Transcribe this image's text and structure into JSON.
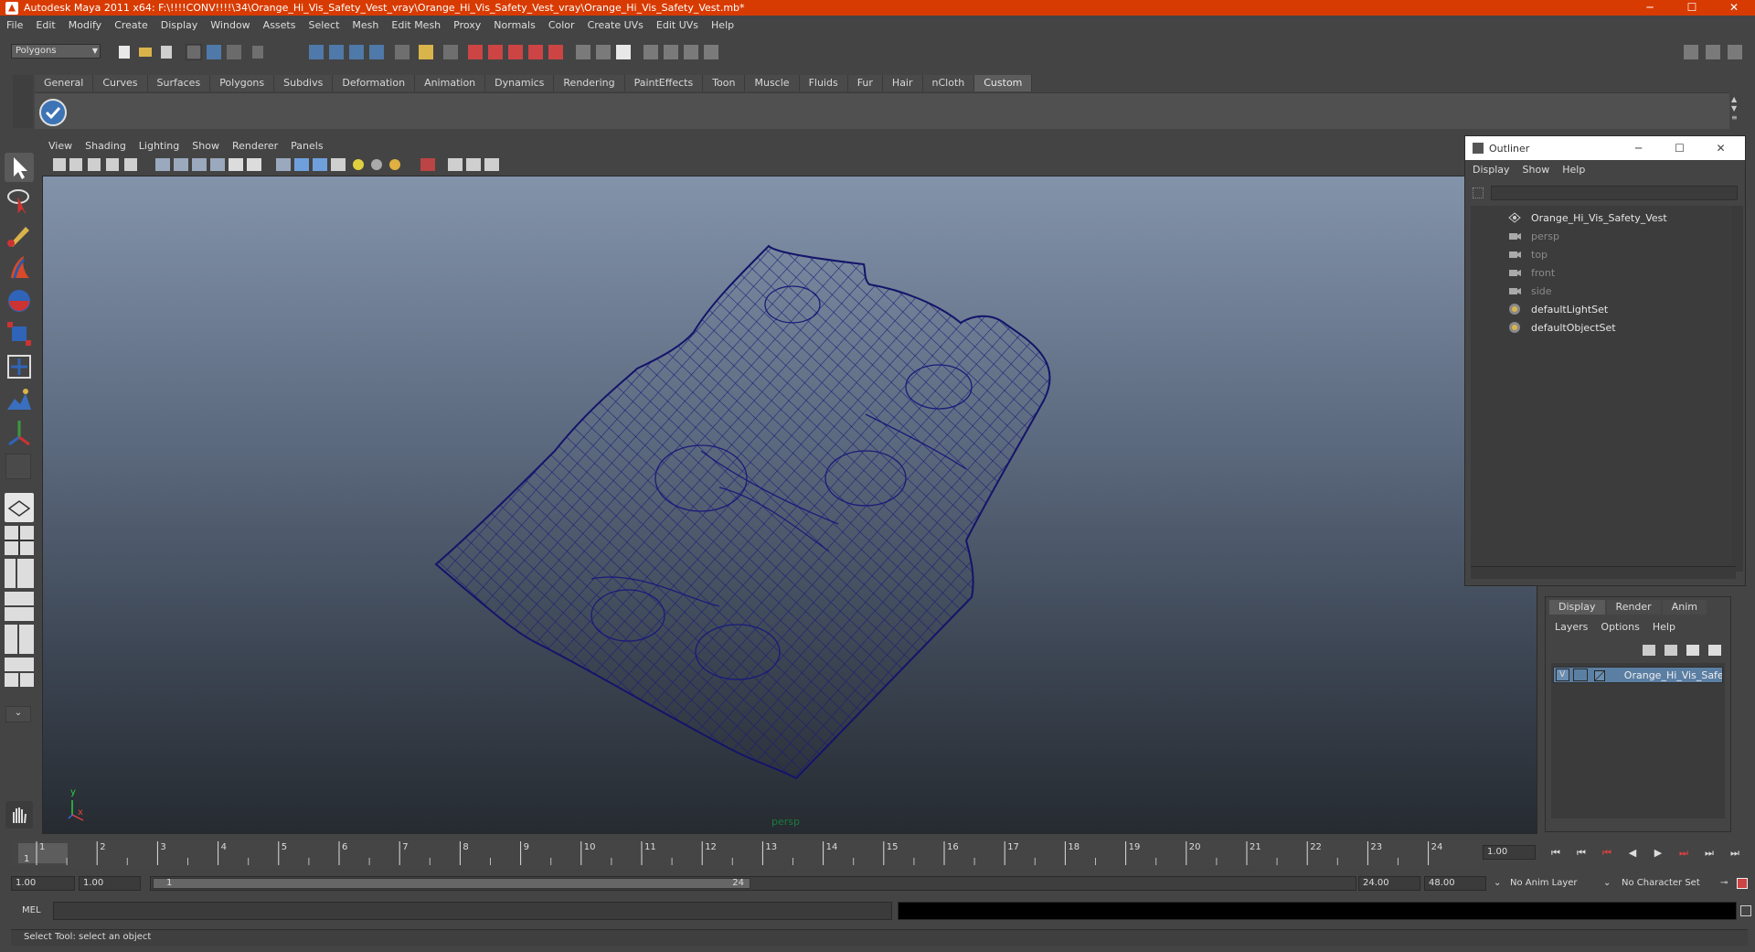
{
  "window": {
    "title": "Autodesk Maya 2011 x64: F:\\!!!!CONV!!!!\\34\\Orange_Hi_Vis_Safety_Vest_vray\\Orange_Hi_Vis_Safety_Vest_vray\\Orange_Hi_Vis_Safety_Vest.mb*",
    "minimize": "─",
    "maximize": "☐",
    "close": "✕"
  },
  "menubar": [
    "File",
    "Edit",
    "Modify",
    "Create",
    "Display",
    "Window",
    "Assets",
    "Select",
    "Mesh",
    "Edit Mesh",
    "Proxy",
    "Normals",
    "Color",
    "Create UVs",
    "Edit UVs",
    "Help"
  ],
  "statusline": {
    "mode": "Polygons"
  },
  "shelf": {
    "tabs": [
      "General",
      "Curves",
      "Surfaces",
      "Polygons",
      "Subdivs",
      "Deformation",
      "Animation",
      "Dynamics",
      "Rendering",
      "PaintEffects",
      "Toon",
      "Muscle",
      "Fluids",
      "Fur",
      "Hair",
      "nCloth",
      "Custom"
    ],
    "active_tab": "Custom"
  },
  "viewport": {
    "menu": [
      "View",
      "Shading",
      "Lighting",
      "Show",
      "Renderer",
      "Panels"
    ],
    "camera_label": "persp",
    "axis_y": "y",
    "axis_x": "x",
    "wire_color": "#1a1a7a"
  },
  "outliner": {
    "title": "Outliner",
    "menu": [
      "Display",
      "Show",
      "Help"
    ],
    "items": [
      {
        "label": "Orange_Hi_Vis_Safety_Vest",
        "icon": "mesh-transform-icon",
        "dim": false
      },
      {
        "label": "persp",
        "icon": "camera-icon",
        "dim": true
      },
      {
        "label": "top",
        "icon": "camera-icon",
        "dim": true
      },
      {
        "label": "front",
        "icon": "camera-icon",
        "dim": true
      },
      {
        "label": "side",
        "icon": "camera-icon",
        "dim": true
      },
      {
        "label": "defaultLightSet",
        "icon": "set-icon",
        "dim": false
      },
      {
        "label": "defaultObjectSet",
        "icon": "set-icon",
        "dim": false
      }
    ]
  },
  "layers": {
    "tabs": [
      "Display",
      "Render",
      "Anim"
    ],
    "active_tab": "Display",
    "menu": [
      "Layers",
      "Options",
      "Help"
    ],
    "rows": [
      {
        "visible": "V",
        "name": "Orange_Hi_Vis_Safety_V"
      }
    ]
  },
  "timeslider": {
    "ticks": [
      "1",
      "2",
      "3",
      "4",
      "5",
      "6",
      "7",
      "8",
      "9",
      "10",
      "11",
      "12",
      "13",
      "14",
      "15",
      "16",
      "17",
      "18",
      "19",
      "20",
      "21",
      "22",
      "23",
      "24"
    ],
    "current_frame_marker": "1",
    "current_frame": "1.00"
  },
  "rangeslider": {
    "start_time": "1.00",
    "playback_start": "1.00",
    "range_start_label": "1",
    "range_end_label": "24",
    "playback_end": "24.00",
    "end_time": "48.00",
    "anim_layer": "No Anim Layer",
    "character_set": "No Character Set"
  },
  "commandline": {
    "label": "MEL"
  },
  "helpline": {
    "text": "Select Tool: select an object"
  },
  "colors": {
    "title_bar": "#d83b01",
    "ui_bg": "#444444",
    "selection": "#5b7fa3"
  }
}
